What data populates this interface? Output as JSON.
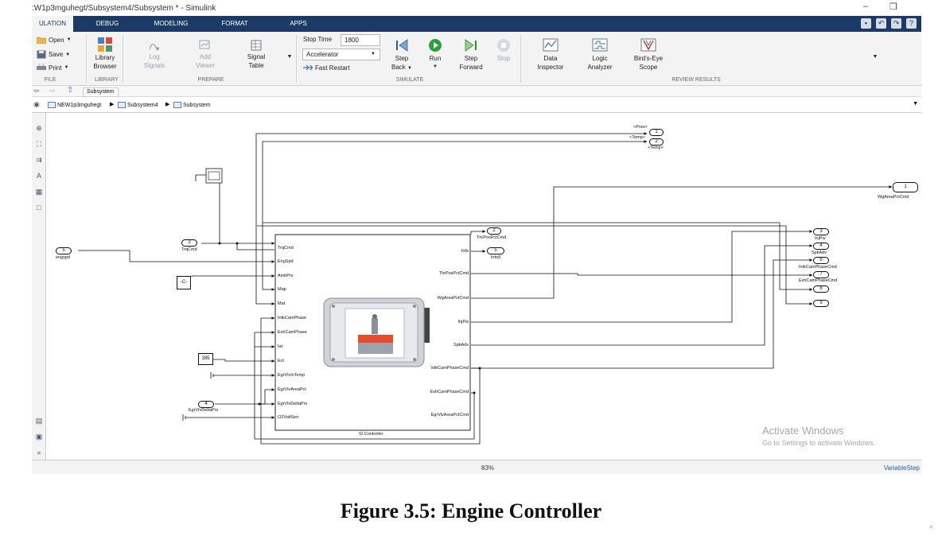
{
  "window": {
    "title": ":W1p3mguhegt/Subsystem4/Subsystem * - Simulink",
    "minimize_glyph": "–",
    "restore_glyph": "❐"
  },
  "tabs": [
    {
      "label": "ULATION",
      "active": true
    },
    {
      "label": "DEBUG",
      "active": false
    },
    {
      "label": "MODELING",
      "active": false
    },
    {
      "label": "FORMAT",
      "active": false
    },
    {
      "label": "APPS",
      "active": false
    }
  ],
  "ribbon": {
    "file": {
      "label": "FILE",
      "open": "Open",
      "save": "Save",
      "print": "Print"
    },
    "library": {
      "label": "LIBRARY",
      "browser_l1": "Library",
      "browser_l2": "Browser"
    },
    "prepare": {
      "label": "PREPARE",
      "log_l1": "Log",
      "log_l2": "Signals",
      "add_l1": "Add",
      "add_l2": "Viewer",
      "signal_l1": "Signal",
      "signal_l2": "Table"
    },
    "simulate": {
      "label": "SIMULATE",
      "stop_time_label": "Stop Time",
      "stop_time_value": "1800",
      "mode": "Accelerator",
      "fast_restart": "Fast Restart",
      "step_back_l1": "Step",
      "step_back_l2": "Back",
      "run": "Run",
      "step_fwd_l1": "Step",
      "step_fwd_l2": "Forward",
      "stop": "Stop"
    },
    "review": {
      "label": "REVIEW RESULTS",
      "data_l1": "Data",
      "data_l2": "Inspector",
      "logic_l1": "Logic",
      "logic_l2": "Analyzer",
      "birds_l1": "Bird's-Eye",
      "birds_l2": "Scope"
    }
  },
  "nav": {
    "tab": "Subsystem"
  },
  "breadcrumb": [
    "NEW1p3mguhegt",
    "Subsystem4",
    "Subsystem"
  ],
  "diagram": {
    "goto_tags": {
      "pres": "<Pres>",
      "temp": "<Temp>",
      "temp_below": "<Temp>"
    },
    "inports": [
      {
        "num": "5",
        "name": "engspd"
      },
      {
        "num": "3",
        "name": "TrqCmd"
      },
      {
        "num": "4",
        "name": "EgrVlvDeltaPrs"
      }
    ],
    "top_outports": [
      "1",
      "2"
    ],
    "constant_c": "-C-",
    "constant_385": "385",
    "controller": {
      "name": "SI Controller",
      "inputs": [
        "TrqCmd",
        "EngSpd",
        "AmbPrs",
        "Map",
        "Mat",
        "IntkCamPhase",
        "ExhCamPhase",
        "Iat",
        "Ect",
        "EgrVlvInTemp",
        "EgrVlvAreaPct",
        "EgrVlvDeltaPrs",
        "O2VoltSen"
      ],
      "outputs": [
        "Info",
        "ThrPosPctCmd",
        "WgAreaPctCmd",
        "InjPw",
        "SpkAdv",
        "IntkCamPhaseCmd",
        "ExhCamPhaseCmd",
        "EgrVlvAreaPctCmd"
      ]
    },
    "info_outs": [
      {
        "num": "2",
        "name": "ThrPosPctCmd"
      },
      {
        "num": "5",
        "name": "Info9"
      }
    ],
    "right_outs": [
      {
        "num": "1",
        "name": "WgAreaPctCmd"
      },
      {
        "num": "3",
        "name": "InjPw"
      },
      {
        "num": "4",
        "name": "SpkAdv"
      },
      {
        "num": "6",
        "name": "IntkCamPhaseCmd"
      },
      {
        "num": "7",
        "name": "ExhCamPhaseCmd"
      },
      {
        "num": "8",
        "name": ""
      },
      {
        "num": "9",
        "name": ""
      }
    ]
  },
  "watermark": {
    "line1": "Activate Windows",
    "line2": "Go to Settings to activate Windows."
  },
  "status": {
    "zoom": "83%",
    "solver": "VariableStep"
  },
  "caption": "Figure 3.5: Engine Controller",
  "colors": {
    "tab_bar": "#1b3b66",
    "ribbon": "#f3f3f3",
    "run_green": "#2e9e3e"
  }
}
